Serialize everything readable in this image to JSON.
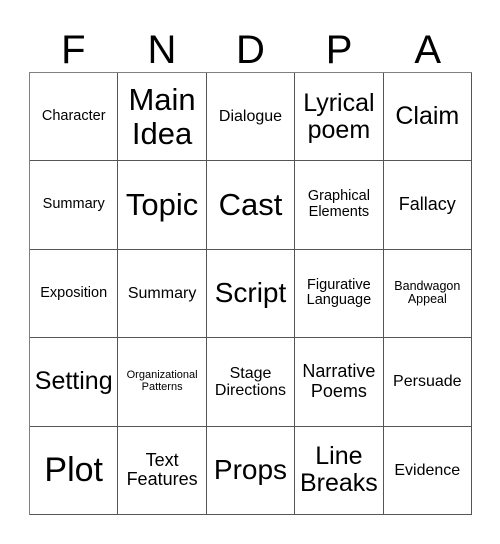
{
  "card": {
    "type": "bingo-card",
    "columns": 5,
    "rows": 5,
    "background_color": "#ffffff",
    "text_color": "#000000",
    "border_color": "#555555"
  },
  "header": {
    "letters": [
      {
        "label": "F"
      },
      {
        "label": "N"
      },
      {
        "label": "D"
      },
      {
        "label": "P"
      },
      {
        "label": "A"
      }
    ]
  },
  "grid": {
    "cells": [
      {
        "label": "Character",
        "size": "m"
      },
      {
        "label": "Main Idea",
        "size": "h2"
      },
      {
        "label": "Dialogue",
        "size": "ml"
      },
      {
        "label": "Lyrical poem",
        "size": "xxl"
      },
      {
        "label": "Claim",
        "size": "xxl"
      },
      {
        "label": "Summary",
        "size": "m"
      },
      {
        "label": "Topic",
        "size": "h2"
      },
      {
        "label": "Cast",
        "size": "h2"
      },
      {
        "label": "Graphical Elements",
        "size": "m"
      },
      {
        "label": "Fallacy",
        "size": "l"
      },
      {
        "label": "Exposition",
        "size": "m"
      },
      {
        "label": "Summary",
        "size": "ml"
      },
      {
        "label": "Script",
        "size": "h1"
      },
      {
        "label": "Figurative Language",
        "size": "m"
      },
      {
        "label": "Bandwagon Appeal",
        "size": "s"
      },
      {
        "label": "Setting",
        "size": "xxl"
      },
      {
        "label": "Organizational Patterns",
        "size": "xs"
      },
      {
        "label": "Stage Directions",
        "size": "ml"
      },
      {
        "label": "Narrative Poems",
        "size": "l"
      },
      {
        "label": "Persuade",
        "size": "ml"
      },
      {
        "label": "Plot",
        "size": "h3"
      },
      {
        "label": "Text Features",
        "size": "l"
      },
      {
        "label": "Props",
        "size": "h1"
      },
      {
        "label": "Line Breaks",
        "size": "xxl"
      },
      {
        "label": "Evidence",
        "size": "ml"
      }
    ]
  }
}
